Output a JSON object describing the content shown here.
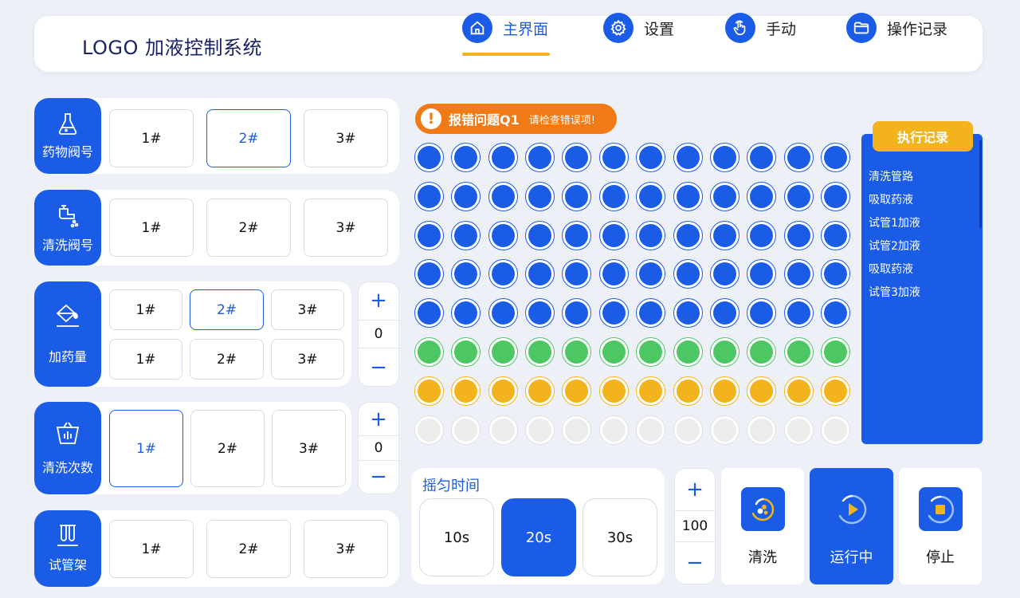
{
  "header": {
    "logo": "LOGO 加液控制系统",
    "nav": [
      {
        "label": "主界面",
        "icon": "home-icon",
        "active": true
      },
      {
        "label": "设置",
        "icon": "gear-icon",
        "active": false
      },
      {
        "label": "手动",
        "icon": "hand-icon",
        "active": false
      },
      {
        "label": "操作记录",
        "icon": "folder-icon",
        "active": false
      }
    ]
  },
  "drug_valve": {
    "label": "药物阀号",
    "icon": "flask-icon",
    "options": [
      "1#",
      "2#",
      "3#"
    ],
    "selected": "2#"
  },
  "wash_valve": {
    "label": "清洗阀号",
    "icon": "faucet-icon",
    "options": [
      "1#",
      "2#",
      "3#"
    ],
    "selected": null
  },
  "dose": {
    "label": "加药量",
    "icon": "paint-bucket-icon",
    "row1": [
      "1#",
      "2#",
      "3#"
    ],
    "row2": [
      "1#",
      "2#",
      "3#"
    ],
    "selected": "row1-2#",
    "stepper": {
      "plus": "+",
      "value": "0",
      "minus": "−"
    }
  },
  "wash_count": {
    "label": "清洗次数",
    "icon": "basket-icon",
    "options": [
      "1#",
      "2#",
      "3#"
    ],
    "selected": "1#",
    "stepper": {
      "plus": "+",
      "value": "0",
      "minus": "−"
    }
  },
  "rack": {
    "label": "试管架",
    "icon": "test-tubes-icon",
    "options": [
      "1#",
      "2#",
      "3#"
    ],
    "selected": null
  },
  "error": {
    "title": "报错问题Q1",
    "message": "请检查错误项!"
  },
  "wells": {
    "columns": 12,
    "row_states": [
      "blue",
      "blue",
      "blue",
      "blue",
      "blue",
      "green",
      "yellow",
      "gray"
    ],
    "colors": {
      "blue": {
        "fill": "#1b5ce6",
        "ring": "#1b5ce6"
      },
      "green": {
        "fill": "#4cc764",
        "ring": "#4cc764"
      },
      "yellow": {
        "fill": "#f3b31c",
        "ring": "#f3b31c"
      },
      "gray": {
        "fill": "#ececec",
        "ring": "#e0e0e0"
      }
    }
  },
  "log": {
    "title": "执行记录",
    "items": [
      "清洗管路",
      "吸取药液",
      "试管1加液",
      "试管2加液",
      "吸取药液",
      "试管3加液"
    ]
  },
  "shake": {
    "title": "摇匀时间",
    "options": [
      "10s",
      "20s",
      "30s"
    ],
    "selected": "20s"
  },
  "count_stepper": {
    "plus": "+",
    "value": "100",
    "minus": "−"
  },
  "actions": [
    {
      "label": "清洗",
      "icon": "wash-icon"
    },
    {
      "label": "运行中",
      "icon": "play-icon",
      "active": true
    },
    {
      "label": "停止",
      "icon": "stop-icon"
    }
  ],
  "accent_colors": {
    "primary": "#1b5ce6",
    "warning": "#f07a15",
    "highlight": "#f3b31c"
  }
}
